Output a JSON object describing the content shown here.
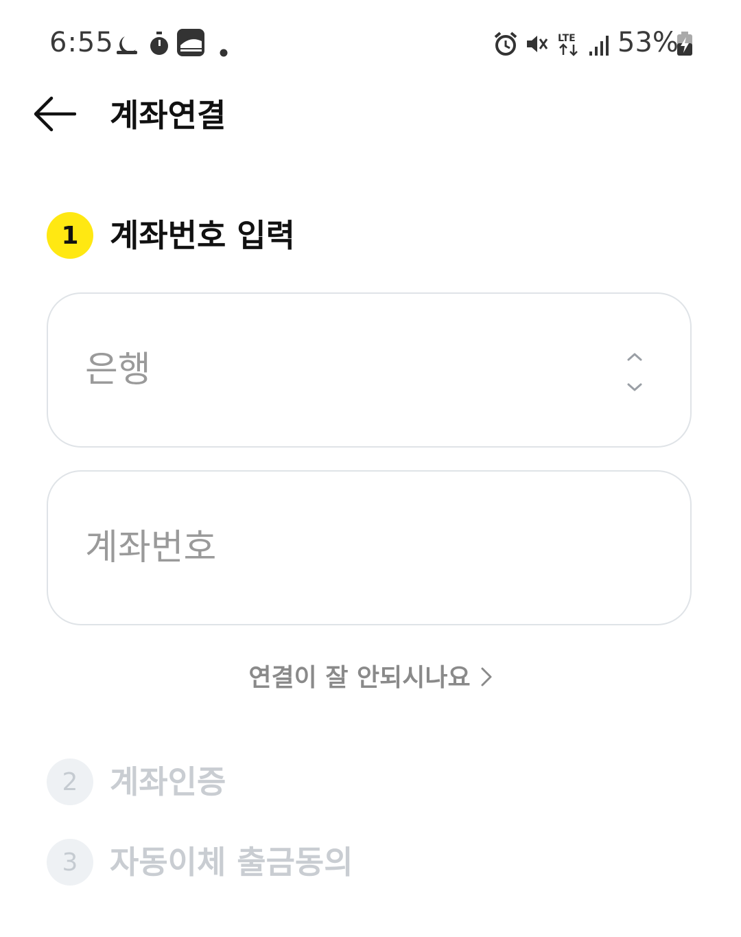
{
  "status_bar": {
    "time": "6:55",
    "icons_left": [
      "moon-icon",
      "stopwatch-icon",
      "ktx-app-icon",
      "notification-dot-icon"
    ],
    "icons_right": [
      "alarm-icon",
      "mute-vibrate-icon",
      "lte-icon",
      "signal-icon",
      "battery-charging-icon"
    ],
    "network": "LTE",
    "battery": "53%"
  },
  "header": {
    "back_icon": "arrow-left-icon",
    "title": "계좌연결"
  },
  "steps": [
    {
      "number": "1",
      "label": "계좌번호 입력",
      "state": "active"
    },
    {
      "number": "2",
      "label": "계좌인증",
      "state": "inactive"
    },
    {
      "number": "3",
      "label": "자동이체 출금동의",
      "state": "inactive"
    }
  ],
  "form": {
    "bank_select": {
      "placeholder": "은행",
      "icon": "chevron-up-down-icon"
    },
    "account_input": {
      "placeholder": "계좌번호"
    }
  },
  "help": {
    "label": "연결이 잘 안되시나요",
    "icon": "chevron-right-icon"
  },
  "colors": {
    "accent": "#ffe812",
    "inactive_badge": "#eef1f4",
    "inactive_text": "#c9cdd2",
    "field_border": "#dfe3e7",
    "placeholder": "#9a9a9a"
  }
}
